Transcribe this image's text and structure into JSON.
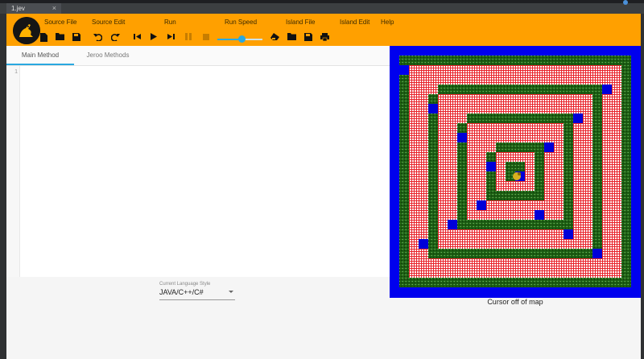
{
  "browser": {
    "tab_title": "1.jev",
    "tab_close": "×"
  },
  "toolbar": {
    "menus": [
      {
        "key": "source_file",
        "label": "Source File"
      },
      {
        "key": "source_edit",
        "label": "Source Edit"
      },
      {
        "key": "run",
        "label": "Run"
      },
      {
        "key": "run_speed",
        "label": "Run Speed"
      },
      {
        "key": "island_file",
        "label": "Island File"
      },
      {
        "key": "island_edit",
        "label": "Island Edit"
      },
      {
        "key": "help",
        "label": "Help"
      }
    ],
    "icons": [
      "new-file-icon",
      "open-folder-icon",
      "save-icon",
      "undo-icon",
      "redo-icon",
      "reset-icon",
      "play-icon",
      "step-icon",
      "pause-icon",
      "stop-icon",
      "clear-map-icon",
      "open-map-icon",
      "save-map-icon",
      "print-icon"
    ],
    "run_speed_fraction": 0.55,
    "colors": {
      "toolbar": "#ffa000",
      "accent": "#29a8e0"
    }
  },
  "editor": {
    "tabs": [
      {
        "label": "Main Method",
        "active": true
      },
      {
        "label": "Jeroo Methods",
        "active": false
      }
    ],
    "line_numbers": [
      "1"
    ],
    "code": ""
  },
  "language": {
    "label": "Current Language Style",
    "value": "JAVA/C++/C#"
  },
  "map": {
    "status": "Cursor off of map",
    "colors": {
      "water": "#0000ee",
      "net": "#e8222a",
      "grass": "#1d5f14",
      "flower": "#0000d8"
    }
  }
}
